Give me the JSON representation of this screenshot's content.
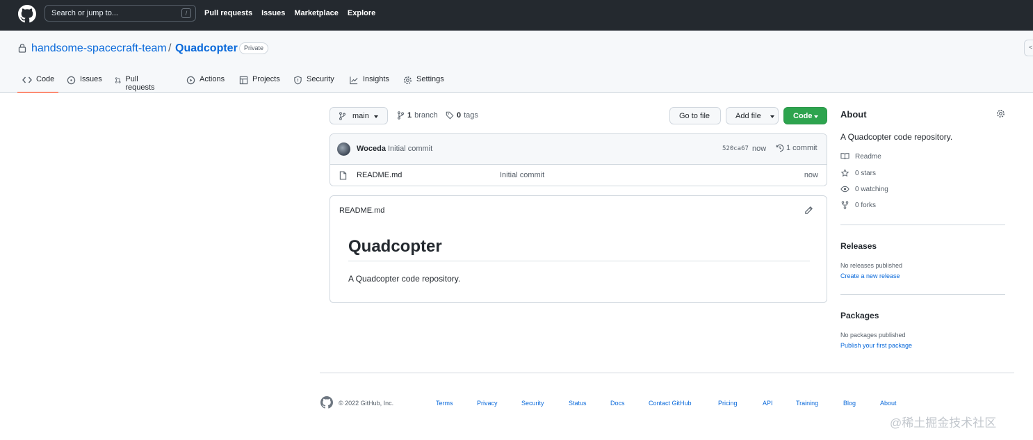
{
  "topbar": {
    "search_placeholder": "Search or jump to...",
    "search_shortcut": "/",
    "nav": [
      "Pull requests",
      "Issues",
      "Marketplace",
      "Explore"
    ]
  },
  "repo": {
    "owner": "handsome-spacecraft-team",
    "separator": "/",
    "name": "Quadcopter",
    "visibility": "Private"
  },
  "tabs": [
    {
      "label": "Code",
      "icon": "code-icon",
      "active": true
    },
    {
      "label": "Issues",
      "icon": "issue-icon"
    },
    {
      "label": "Pull requests",
      "icon": "pull-request-icon"
    },
    {
      "label": "Actions",
      "icon": "play-icon"
    },
    {
      "label": "Projects",
      "icon": "table-icon"
    },
    {
      "label": "Security",
      "icon": "shield-icon"
    },
    {
      "label": "Insights",
      "icon": "graph-icon"
    },
    {
      "label": "Settings",
      "icon": "gear-icon"
    }
  ],
  "toolbar": {
    "branch": "main",
    "branch_count": "1",
    "branch_label": "branch",
    "tag_count": "0",
    "tag_label": "tags",
    "go_to_file": "Go to file",
    "add_file": "Add file",
    "code": "Code"
  },
  "commit": {
    "author": "Woceda",
    "message": "Initial commit",
    "sha": "520ca67",
    "time": "now",
    "count": "1 commit"
  },
  "files": [
    {
      "name": "README.md",
      "message": "Initial commit",
      "time": "now"
    }
  ],
  "readme": {
    "filename": "README.md",
    "heading": "Quadcopter",
    "body": "A Quadcopter code repository."
  },
  "about": {
    "title": "About",
    "description": "A Quadcopter code repository.",
    "readme": "Readme",
    "stars": "0 stars",
    "watching": "0 watching",
    "forks": "0 forks"
  },
  "releases": {
    "title": "Releases",
    "status": "No releases published",
    "link": "Create a new release"
  },
  "packages": {
    "title": "Packages",
    "status": "No packages published",
    "link": "Publish your first package"
  },
  "footer": {
    "copyright": "© 2022 GitHub, Inc.",
    "links": [
      "Terms",
      "Privacy",
      "Security",
      "Status",
      "Docs",
      "Contact GitHub",
      "Pricing",
      "API",
      "Training",
      "Blog",
      "About"
    ]
  },
  "watermark": "@稀土掘金技术社区",
  "colors": {
    "header_bg": "#24292f",
    "link": "#0969da",
    "primary_button": "#2da44e",
    "active_tab_underline": "#fd8c73"
  }
}
